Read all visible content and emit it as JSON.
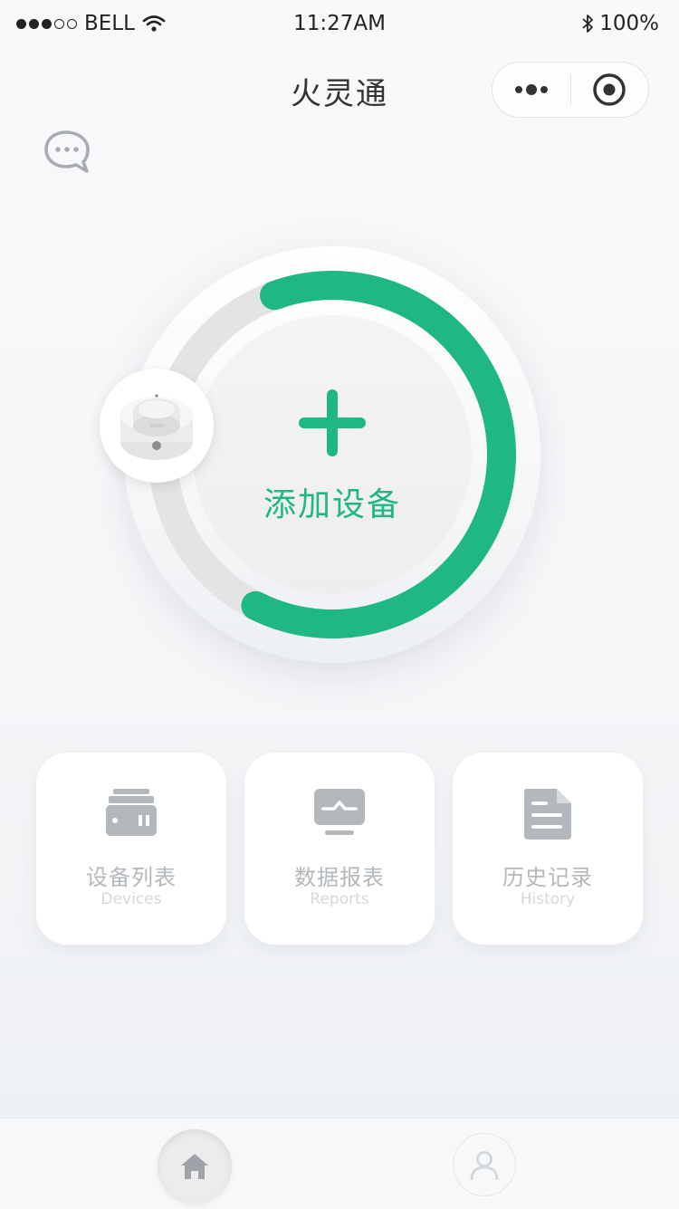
{
  "status_bar": {
    "signal": "●●●○○",
    "carrier": "BELL",
    "time": "11:27AM",
    "battery": "100%",
    "icons": [
      "wifi-icon",
      "bluetooth-icon"
    ]
  },
  "nav": {
    "title": "火灵通",
    "capsule_icons": [
      "more-icon",
      "close-miniprogram-icon"
    ]
  },
  "main": {
    "add_device_label": "添加设备",
    "progress_fraction": 0.63,
    "accent_color": "#1fb784"
  },
  "cards": [
    {
      "title": "设备列表",
      "subtitle": "Devices",
      "icon": "device-list-icon"
    },
    {
      "title": "数据报表",
      "subtitle": "Reports",
      "icon": "reports-monitor-icon"
    },
    {
      "title": "历史记录",
      "subtitle": "History",
      "icon": "history-document-icon"
    }
  ],
  "tabbar": {
    "tabs": [
      {
        "icon": "home-icon",
        "active": true
      },
      {
        "icon": "user-icon",
        "active": false
      }
    ]
  }
}
